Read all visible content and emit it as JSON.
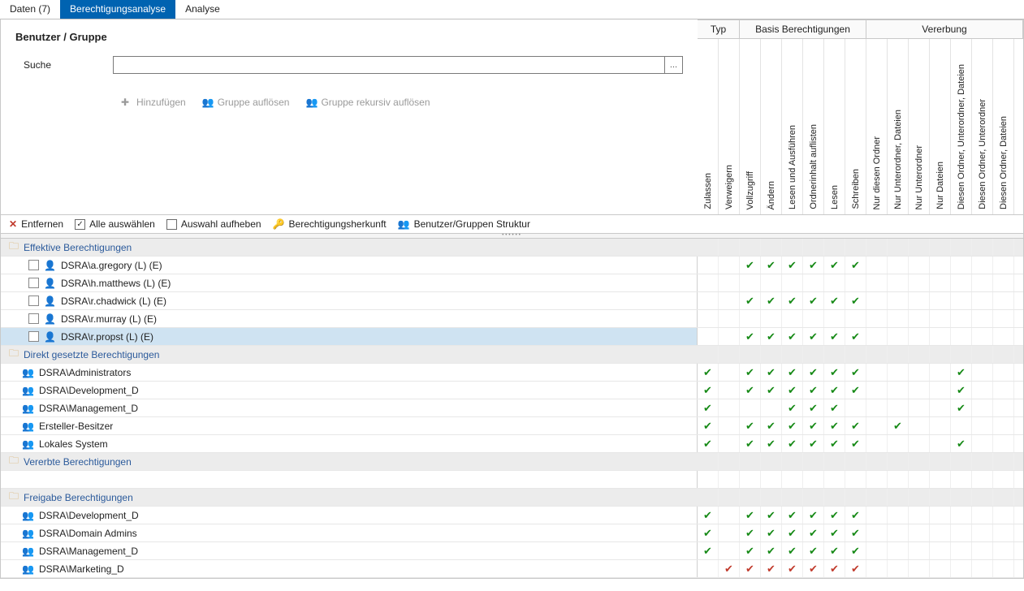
{
  "tabs": {
    "data": "Daten (7)",
    "analysis": "Berechtigungsanalyse",
    "analyse": "Analyse"
  },
  "filter": {
    "title": "Benutzer / Gruppe",
    "search_label": "Suche",
    "search_value": "",
    "browse": "...",
    "btn_add": "Hinzufügen",
    "btn_resolve": "Gruppe auflösen",
    "btn_resolve_rec": "Gruppe rekursiv auflösen"
  },
  "col_groups": {
    "typ": "Typ",
    "basis": "Basis Berechtigungen",
    "vererbung": "Vererbung"
  },
  "cols": [
    "Zulassen",
    "Verweigern",
    "Vollzugriff",
    "Ändern",
    "Lesen und Ausführen",
    "Ordnerinhalt auflisten",
    "Lesen",
    "Schreiben",
    "Nur diesen Ordner",
    "Nur Unterordner, Dateien",
    "Nur Unterordner",
    "Nur Dateien",
    "Diesen Ordner, Unterordner, Dateien",
    "Diesen Ordner, Unterordner",
    "Diesen Ordner, Dateien"
  ],
  "toolbar": {
    "remove": "Entfernen",
    "select_all": "Alle auswählen",
    "deselect": "Auswahl aufheben",
    "origin": "Berechtigungsherkunft",
    "structure": "Benutzer/Gruppen Struktur"
  },
  "groups": [
    {
      "title": "Effektive Berechtigungen",
      "rows": [
        {
          "icon": "user",
          "name": "DSRA\\a.gregory (L) (E)",
          "chk": true,
          "sel": false,
          "perm": [
            "",
            "",
            "v",
            "v",
            "v",
            "v",
            "v",
            "v",
            "",
            "",
            "",
            "",
            "",
            "",
            ""
          ]
        },
        {
          "icon": "user",
          "name": "DSRA\\h.matthews (L) (E)",
          "chk": true,
          "sel": false,
          "perm": [
            "",
            "",
            "",
            "",
            "",
            "",
            "",
            "",
            "",
            "",
            "",
            "",
            "",
            "",
            ""
          ]
        },
        {
          "icon": "user",
          "name": "DSRA\\r.chadwick (L) (E)",
          "chk": true,
          "sel": false,
          "perm": [
            "",
            "",
            "v",
            "v",
            "v",
            "v",
            "v",
            "v",
            "",
            "",
            "",
            "",
            "",
            "",
            ""
          ]
        },
        {
          "icon": "user",
          "name": "DSRA\\r.murray (L) (E)",
          "chk": true,
          "sel": false,
          "perm": [
            "",
            "",
            "",
            "",
            "",
            "",
            "",
            "",
            "",
            "",
            "",
            "",
            "",
            "",
            ""
          ]
        },
        {
          "icon": "user",
          "name": "DSRA\\r.propst (L) (E)",
          "chk": true,
          "sel": true,
          "perm": [
            "",
            "",
            "v",
            "v",
            "v",
            "v",
            "v",
            "v",
            "",
            "",
            "",
            "",
            "",
            "",
            ""
          ]
        }
      ]
    },
    {
      "title": "Direkt gesetzte Berechtigungen",
      "rows": [
        {
          "icon": "group",
          "name": "DSRA\\Administrators",
          "perm": [
            "v",
            "",
            "v",
            "v",
            "v",
            "v",
            "v",
            "v",
            "",
            "",
            "",
            "",
            "v",
            "",
            ""
          ]
        },
        {
          "icon": "group",
          "name": "DSRA\\Development_D",
          "perm": [
            "v",
            "",
            "v",
            "v",
            "v",
            "v",
            "v",
            "v",
            "",
            "",
            "",
            "",
            "v",
            "",
            ""
          ]
        },
        {
          "icon": "group",
          "name": "DSRA\\Management_D",
          "perm": [
            "v",
            "",
            "",
            "",
            "v",
            "v",
            "v",
            "",
            "",
            "",
            "",
            "",
            "v",
            "",
            ""
          ]
        },
        {
          "icon": "group",
          "name": "Ersteller-Besitzer",
          "perm": [
            "v",
            "",
            "v",
            "v",
            "v",
            "v",
            "v",
            "v",
            "",
            "v",
            "",
            "",
            "",
            "",
            ""
          ]
        },
        {
          "icon": "group",
          "name": "Lokales System",
          "perm": [
            "v",
            "",
            "v",
            "v",
            "v",
            "v",
            "v",
            "v",
            "",
            "",
            "",
            "",
            "v",
            "",
            ""
          ]
        }
      ]
    },
    {
      "title": "Vererbte Berechtigungen",
      "rows": [
        {
          "icon": "",
          "name": "",
          "perm": [
            "",
            "",
            "",
            "",
            "",
            "",
            "",
            "",
            "",
            "",
            "",
            "",
            "",
            "",
            ""
          ]
        }
      ]
    },
    {
      "title": "Freigabe Berechtigungen",
      "rows": [
        {
          "icon": "group",
          "name": "DSRA\\Development_D",
          "perm": [
            "v",
            "",
            "v",
            "v",
            "v",
            "v",
            "v",
            "v",
            "",
            "",
            "",
            "",
            "",
            "",
            ""
          ]
        },
        {
          "icon": "group",
          "name": "DSRA\\Domain Admins",
          "perm": [
            "v",
            "",
            "v",
            "v",
            "v",
            "v",
            "v",
            "v",
            "",
            "",
            "",
            "",
            "",
            "",
            ""
          ]
        },
        {
          "icon": "group",
          "name": "DSRA\\Management_D",
          "perm": [
            "v",
            "",
            "v",
            "v",
            "v",
            "v",
            "v",
            "v",
            "",
            "",
            "",
            "",
            "",
            "",
            ""
          ]
        },
        {
          "icon": "group",
          "name": "DSRA\\Marketing_D",
          "perm": [
            "",
            "d",
            "d",
            "d",
            "d",
            "d",
            "d",
            "d",
            "",
            "",
            "",
            "",
            "",
            "",
            ""
          ]
        }
      ]
    }
  ]
}
